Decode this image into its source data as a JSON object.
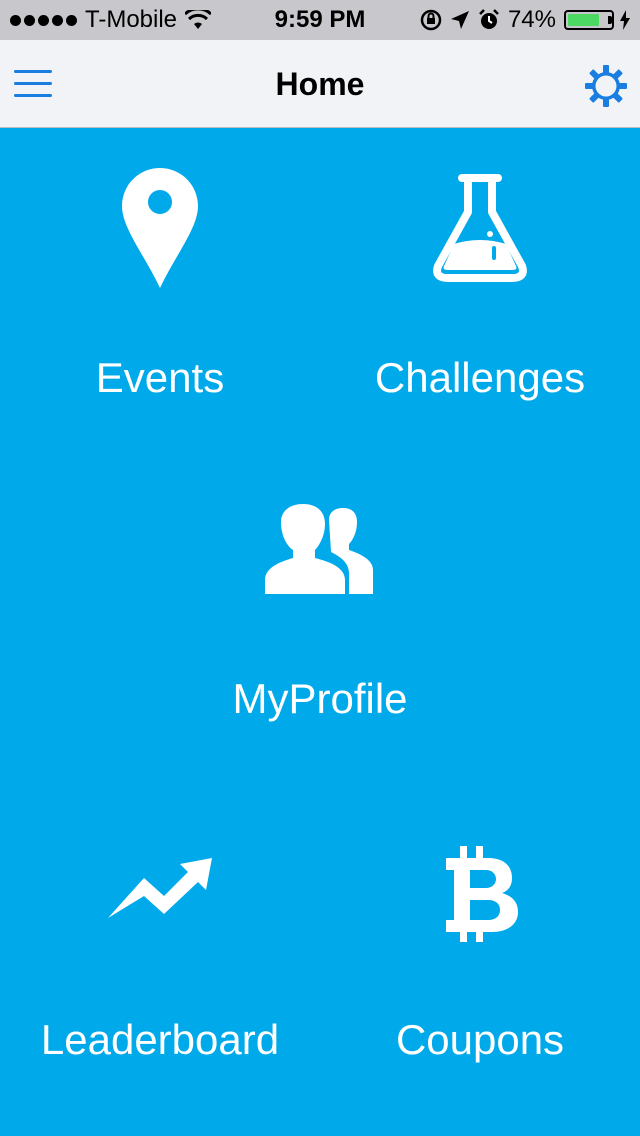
{
  "status_bar": {
    "carrier": "T-Mobile",
    "time": "9:59 PM",
    "battery_percent": "74%",
    "battery_level": 0.74,
    "signal_bars": 5
  },
  "nav": {
    "title": "Home",
    "menu_icon": "hamburger-menu-icon",
    "settings_icon": "gear-icon",
    "accent_color": "#1a7ee0"
  },
  "background_color": "#00aaea",
  "tiles": [
    {
      "label": "Events",
      "icon": "map-pin-icon"
    },
    {
      "label": "Challenges",
      "icon": "flask-icon"
    },
    {
      "label": "MyProfile",
      "icon": "users-icon"
    },
    {
      "label": "Leaderboard",
      "icon": "trending-up-icon"
    },
    {
      "label": "Coupons",
      "icon": "bitcoin-icon"
    }
  ]
}
